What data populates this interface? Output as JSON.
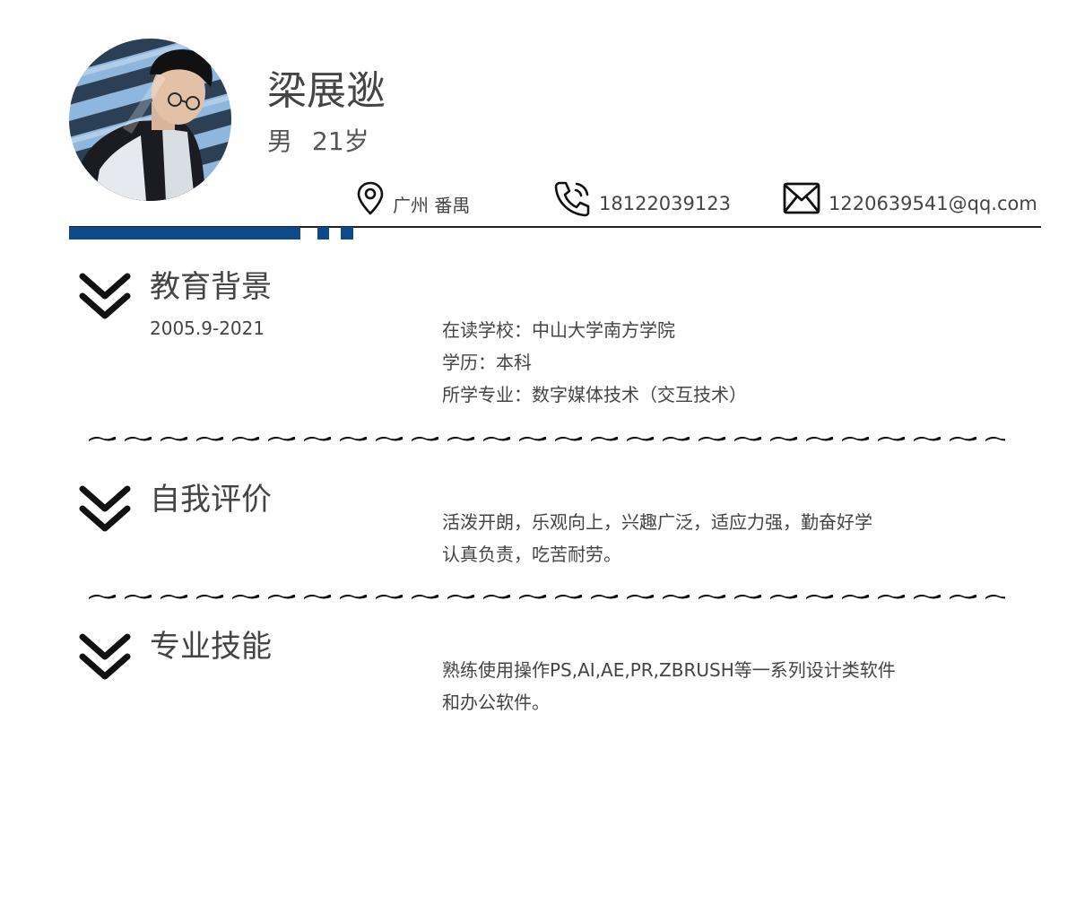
{
  "profile": {
    "name": "梁展逖",
    "gender": "男",
    "age": "21岁",
    "location": "广州 番禺",
    "phone": "18122039123",
    "email": "1220639541@qq.com"
  },
  "sections": {
    "education": {
      "title": "教育背景",
      "date": "2005.9-2021",
      "lines": [
        "在读学校：中山大学南方学院",
        "学历：本科",
        "所学专业：数字媒体技术（交互技术）"
      ]
    },
    "self_evaluation": {
      "title": "自我评价",
      "lines": [
        "活泼开朗，乐观向上，兴趣广泛，适应力强，勤奋好学",
        "认真负责，吃苦耐劳。"
      ]
    },
    "skills": {
      "title": "专业技能",
      "lines": [
        "熟练使用操作PS,AI,AE,PR,ZBRUSH等一系列设计类软件",
        "和办公软件。"
      ]
    }
  },
  "colors": {
    "accent_blue": "#0d4a8a",
    "text": "#444444",
    "icon": "#111111"
  },
  "icons": {
    "location": "map-pin-icon",
    "phone": "phone-icon",
    "email": "mail-icon",
    "section_marker": "double-chevron-down-icon"
  }
}
